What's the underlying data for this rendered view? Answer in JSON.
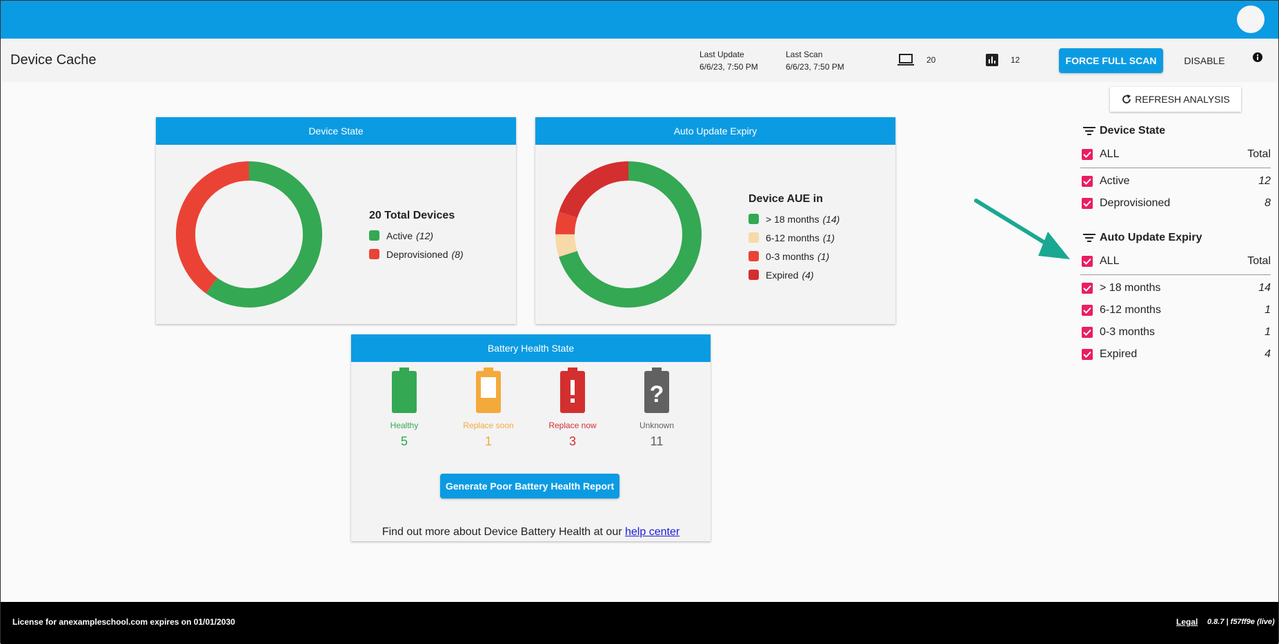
{
  "header": {
    "title": "Device Cache",
    "last_update_label": "Last Update",
    "last_update_value": "6/6/23, 7:50 PM",
    "last_scan_label": "Last Scan",
    "last_scan_value": "6/6/23, 7:50 PM",
    "devices_count": "20",
    "analyzed_count": "12",
    "force_scan_label": "FORCE FULL SCAN",
    "disable_label": "DISABLE"
  },
  "device_state_card": {
    "title": "Device State",
    "legend_title": "20 Total Devices",
    "items": [
      {
        "label": "Active",
        "count": "(12)",
        "color": "#34a853"
      },
      {
        "label": "Deprovisioned",
        "count": "(8)",
        "color": "#ea4335"
      }
    ]
  },
  "aue_card": {
    "title": "Auto Update Expiry",
    "legend_title": "Device AUE in",
    "items": [
      {
        "label": "> 18 months",
        "count": "(14)",
        "color": "#34a853"
      },
      {
        "label": "6-12 months",
        "count": "(1)",
        "color": "#f8d9a8"
      },
      {
        "label": "0-3 months",
        "count": "(1)",
        "color": "#ea4335"
      },
      {
        "label": "Expired",
        "count": "(4)",
        "color": "#d32f2f"
      }
    ]
  },
  "chart_data": [
    {
      "type": "pie",
      "title": "Device State",
      "categories": [
        "Active",
        "Deprovisioned"
      ],
      "values": [
        12,
        8
      ]
    },
    {
      "type": "pie",
      "title": "Auto Update Expiry",
      "categories": [
        "> 18 months",
        "6-12 months",
        "0-3 months",
        "Expired"
      ],
      "values": [
        14,
        1,
        1,
        4
      ]
    }
  ],
  "battery_card": {
    "title": "Battery Health State",
    "states": [
      {
        "label": "Healthy",
        "value": "5",
        "color": "#34a853",
        "icon": "battery-full-icon"
      },
      {
        "label": "Replace soon",
        "value": "1",
        "color": "#f4a93b",
        "icon": "battery-low-icon"
      },
      {
        "label": "Replace now",
        "value": "3",
        "color": "#d32f2f",
        "icon": "battery-alert-icon"
      },
      {
        "label": "Unknown",
        "value": "11",
        "color": "#616161",
        "icon": "battery-unknown-icon"
      }
    ],
    "report_button": "Generate Poor Battery Health Report",
    "help_text": "Find out more about Device Battery Health at our",
    "help_link": "help center"
  },
  "filters": {
    "refresh_label": "REFRESH ANALYSIS",
    "device_state": {
      "title": "Device State",
      "all_label": "ALL",
      "total_label": "Total",
      "items": [
        {
          "label": "Active",
          "count": "12"
        },
        {
          "label": "Deprovisioned",
          "count": "8"
        }
      ]
    },
    "aue": {
      "title": "Auto Update Expiry",
      "all_label": "ALL",
      "total_label": "Total",
      "items": [
        {
          "label": "> 18 months",
          "count": "14"
        },
        {
          "label": "6-12 months",
          "count": "1"
        },
        {
          "label": "0-3 months",
          "count": "1"
        },
        {
          "label": "Expired",
          "count": "4"
        }
      ]
    }
  },
  "footer": {
    "license": "License for anexampleschool.com expires on 01/01/2030",
    "legal": "Legal",
    "version": "0.8.7 | f57ff9e (live)"
  },
  "colors": {
    "primary": "#0b9be3",
    "checkbox": "#e91e63",
    "arrow": "#1aa892"
  }
}
